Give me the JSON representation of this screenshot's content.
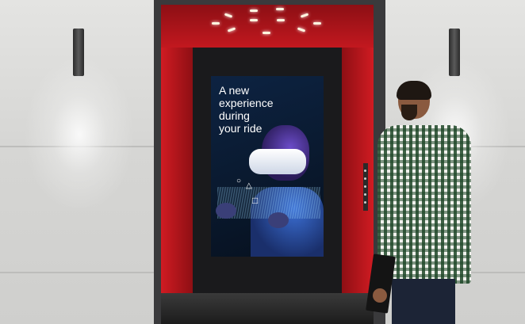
{
  "screen_ad": {
    "headline": "A new\nexperience\nduring\nyour ride"
  },
  "colors": {
    "cabin_red": "#b3161c",
    "screen_navy": "#0d2342",
    "wall": "#d6d6d4"
  },
  "icons": [
    "circle-shape",
    "triangle-shape",
    "square-shape"
  ]
}
